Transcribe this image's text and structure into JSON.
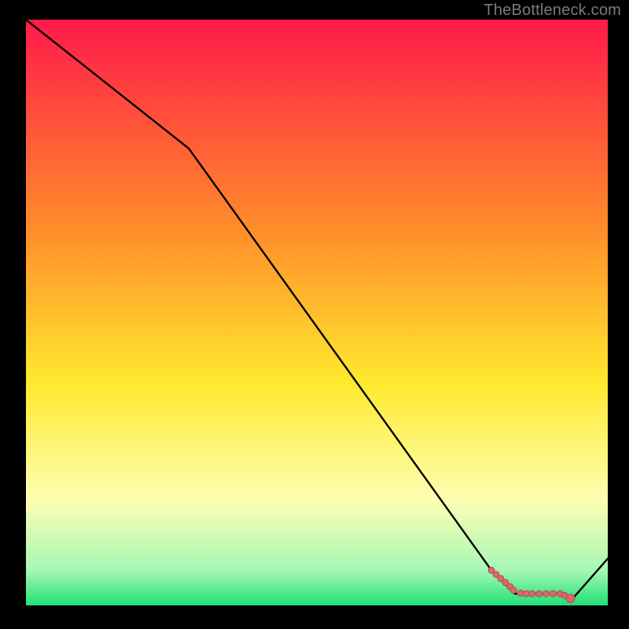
{
  "watermark": "TheBottleneck.com",
  "colors": {
    "gradient_top": "#ff1a4b",
    "gradient_upper_mid": "#ff8a2a",
    "gradient_mid": "#ffe92e",
    "gradient_lower_mid": "#feffb3",
    "gradient_green_light": "#a7f7b5",
    "gradient_green": "#1fe077",
    "curve": "#000000",
    "marker_fill": "#d66a6a",
    "marker_stroke": "#b74f4f",
    "frame": "#000000"
  },
  "chart_data": {
    "type": "line",
    "title": "",
    "xlabel": "",
    "ylabel": "",
    "xlim": [
      0,
      100
    ],
    "ylim": [
      0,
      100
    ],
    "grid": false,
    "legend": false,
    "series": [
      {
        "name": "bottleneck-curve",
        "x": [
          0,
          28,
          80,
          84,
          92,
          94,
          100
        ],
        "y": [
          100,
          78,
          6,
          2,
          2,
          1.2,
          8
        ]
      }
    ],
    "markers": {
      "name": "highlight-segment",
      "x": [
        80.0,
        80.8,
        81.6,
        82.4,
        83.2,
        83.8,
        85.0,
        86.0,
        87.0,
        88.2,
        89.4,
        90.6,
        91.8,
        92.6,
        93.6
      ],
      "y": [
        6.0,
        5.3,
        4.6,
        3.9,
        3.2,
        2.6,
        2.1,
        2.0,
        2.0,
        2.0,
        2.0,
        2.0,
        2.0,
        1.7,
        1.2
      ]
    }
  }
}
